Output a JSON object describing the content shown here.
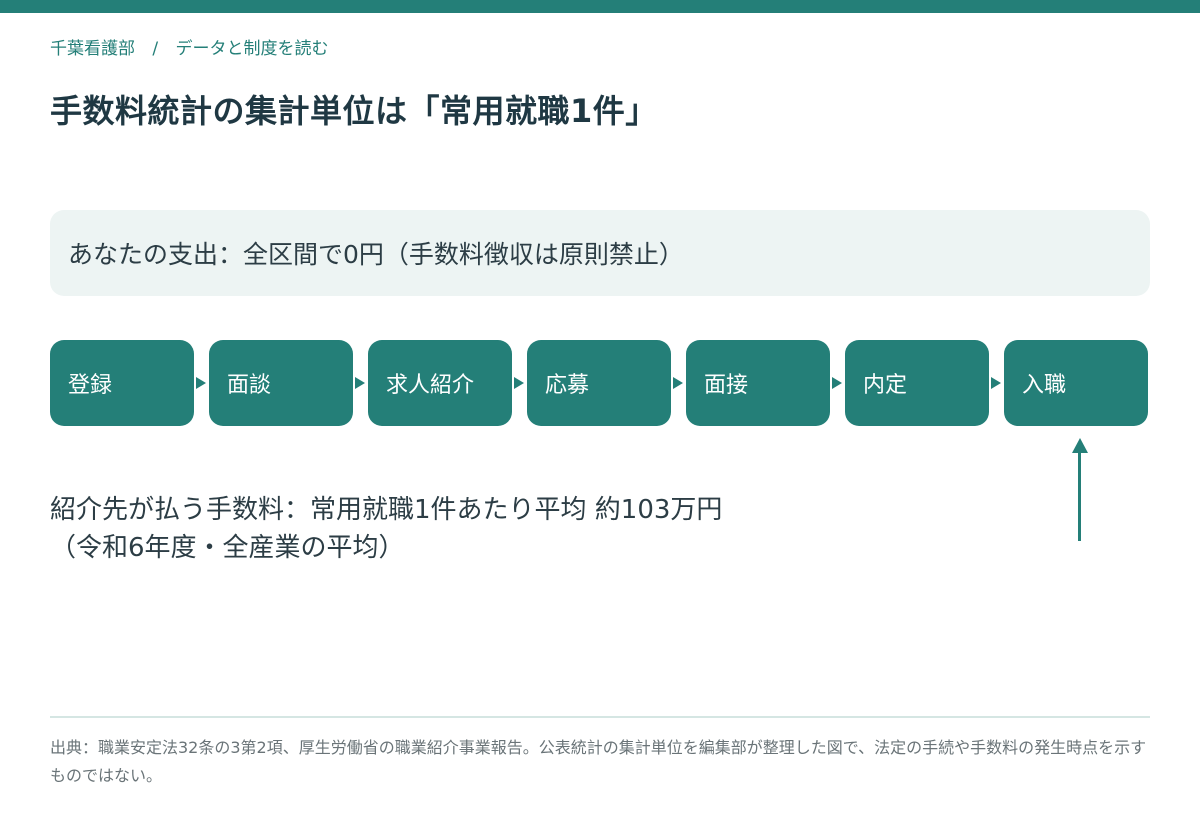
{
  "header": {
    "accent_color": "#247f78",
    "breadcrumb": {
      "site": "千葉看護部",
      "separator": "/",
      "section": "データと制度を読む"
    },
    "title": "手数料統計の集計単位は「常用就職1件」"
  },
  "callout": {
    "text": "あなたの支出：全区間で0円（手数料徴収は原則禁止）",
    "background": "#edf4f3"
  },
  "flow": {
    "step_color": "#247f78",
    "steps": [
      {
        "label": "登録"
      },
      {
        "label": "面談"
      },
      {
        "label": "求人紹介"
      },
      {
        "label": "応募"
      },
      {
        "label": "面接"
      },
      {
        "label": "内定"
      },
      {
        "label": "入職"
      }
    ],
    "highlighted_step": "入職"
  },
  "fee": {
    "line1": "紹介先が払う手数料：常用就職1件あたり平均 約103万円",
    "line2": "（令和6年度・全産業の平均）"
  },
  "footer": {
    "source": "出典：職業安定法32条の3第2項、厚生労働省の職業紹介事業報告。公表統計の集計単位を編集部が整理した図で、法定の手続や手数料の発生時点を示すものではない。"
  }
}
